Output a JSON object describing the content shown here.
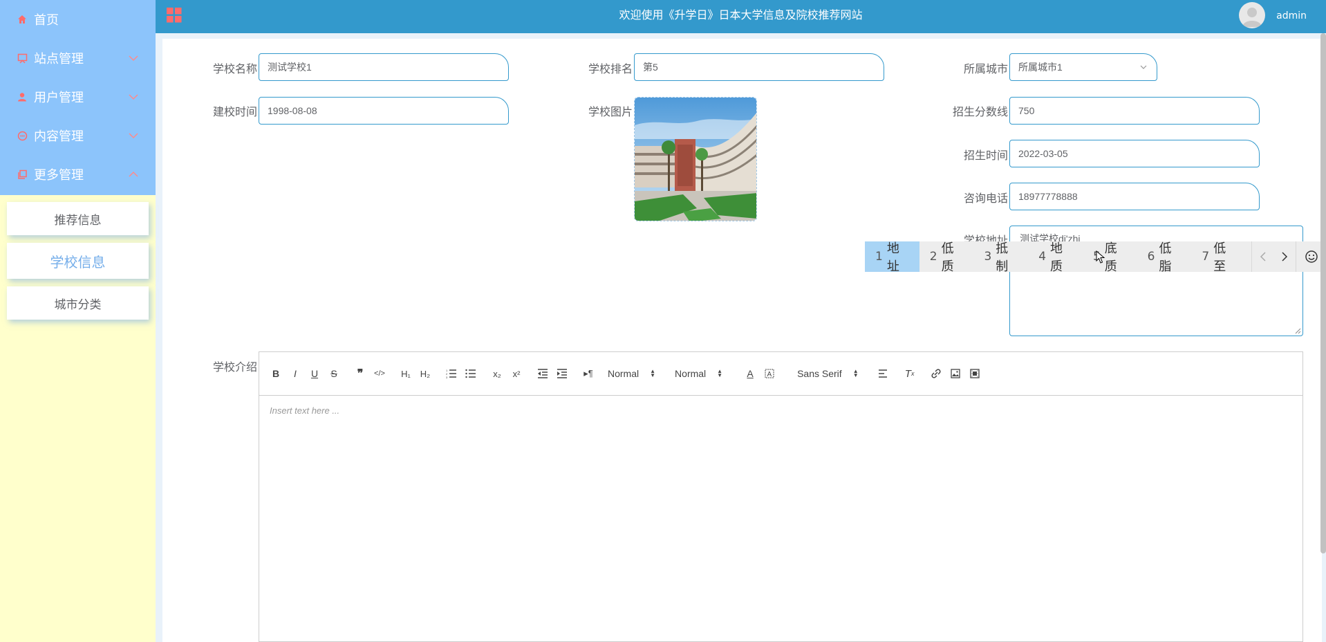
{
  "sidebar": {
    "menu": [
      {
        "label": "首页",
        "icon": "home-icon"
      },
      {
        "label": "站点管理",
        "icon": "monitor-icon"
      },
      {
        "label": "用户管理",
        "icon": "user-icon"
      },
      {
        "label": "内容管理",
        "icon": "content-icon"
      },
      {
        "label": "更多管理",
        "icon": "copy-icon"
      }
    ],
    "submenu": [
      "推荐信息",
      "学校信息",
      "城市分类"
    ],
    "active_submenu": "学校信息"
  },
  "header": {
    "title": "欢迎使用《升学日》日本大学信息及院校推荐网站",
    "username": "admin"
  },
  "form": {
    "school_name": {
      "label": "学校名称",
      "value": "测试学校1"
    },
    "school_rank": {
      "label": "学校排名",
      "value": "第5"
    },
    "city": {
      "label": "所属城市",
      "value": "所属城市1"
    },
    "founded": {
      "label": "建校时间",
      "value": "1998-08-08"
    },
    "school_image": {
      "label": "学校图片"
    },
    "score_line": {
      "label": "招生分数线",
      "value": "750"
    },
    "enroll_time": {
      "label": "招生时间",
      "value": "2022-03-05"
    },
    "phone": {
      "label": "咨询电话",
      "value": "18977778888"
    },
    "address": {
      "label": "学校地址",
      "value": "测试学校di'zhi"
    },
    "intro": {
      "label": "学校介绍",
      "placeholder": "Insert text here ..."
    }
  },
  "ime": {
    "candidates": [
      {
        "n": "1",
        "text": "地址"
      },
      {
        "n": "2",
        "text": "低质"
      },
      {
        "n": "3",
        "text": "抵制"
      },
      {
        "n": "4",
        "text": "地质"
      },
      {
        "n": "5",
        "text": "底质"
      },
      {
        "n": "6",
        "text": "低脂"
      },
      {
        "n": "7",
        "text": "低至"
      }
    ]
  },
  "editor": {
    "header1": "Normal",
    "size": "Normal",
    "font": "Sans Serif"
  },
  "colors": {
    "header": "#3399cc",
    "sidebar_top": "#8cc4fb",
    "sidebar_bg": "#ffffcc",
    "accent": "#75aeea",
    "icon_red": "#ff6b6b"
  }
}
